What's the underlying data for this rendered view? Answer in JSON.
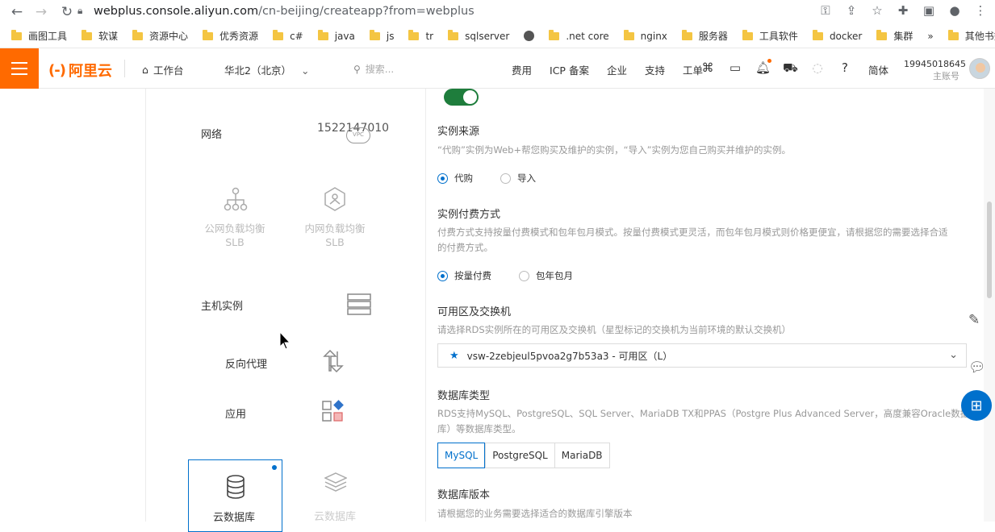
{
  "browser": {
    "url_domain": "webplus.console.aliyun.com",
    "url_path": "/cn-beijing/createapp?from=webplus",
    "bookmarks": [
      "画图工具",
      "软谋",
      "资源中心",
      "优秀资源",
      "c#",
      "java",
      "js",
      "tr",
      "sqlserver",
      "",
      ".net core",
      "nginx",
      "服务器",
      "工具软件",
      "docker",
      "集群",
      "»",
      "其他书签"
    ]
  },
  "header": {
    "logo_text": "阿里云",
    "workbench": "工作台",
    "region": "华北2（北京）",
    "search_placeholder": "搜索...",
    "nav": [
      "费用",
      "ICP 备案",
      "企业",
      "支持",
      "工单"
    ],
    "language": "简体",
    "account_id": "19945018645",
    "account_type": "主账号"
  },
  "left": {
    "network_label": "网络",
    "vpc_number": "1522147010",
    "vpc_badge": "VPC",
    "slb_public": "公网负载均衡",
    "slb_private": "内网负载均衡",
    "slb_suffix": "SLB",
    "host_instance": "主机实例",
    "reverse_proxy": "反向代理",
    "application": "应用",
    "cloud_db": "云数据库",
    "cloud_db2": "云数据库"
  },
  "form": {
    "instance_source_title": "实例来源",
    "instance_source_desc": "“代购”实例为Web+帮您购买及维护的实例，“导入”实例为您自己购买并维护的实例。",
    "source_opt1": "代购",
    "source_opt2": "导入",
    "billing_title": "实例付费方式",
    "billing_desc1": "付费方式支持按量付费模式和包年包月模式。按量付费模式更灵活，而包年包月模式则价格更便宜，请根据您的需要选择合适",
    "billing_desc2": "的付费方式。",
    "billing_opt1": "按量付费",
    "billing_opt2": "包年包月",
    "zone_title": "可用区及交换机",
    "zone_desc": "请选择RDS实例所在的可用区及交换机（星型标记的交换机为当前环境的默认交换机）",
    "zone_value": "vsw-2zebjeul5pvoa2g7b53a3 - 可用区（L）",
    "dbtype_title": "数据库类型",
    "dbtype_desc1": "RDS支持MySQL、PostgreSQL、SQL Server、MariaDB TX和PPAS（Postgre Plus Advanced Server，高度兼容Oracle数据",
    "dbtype_desc2": "库）等数据库类型。",
    "db_mysql": "MySQL",
    "db_postgres": "PostgreSQL",
    "db_mariadb": "MariaDB",
    "dbver_title": "数据库版本",
    "dbver_desc": "请根据您的业务需要选择适合的数据库引擎版本"
  },
  "colors": {
    "accent": "#0070cc",
    "brand": "#ff6a00",
    "toggle_on": "#1e7d3c"
  }
}
